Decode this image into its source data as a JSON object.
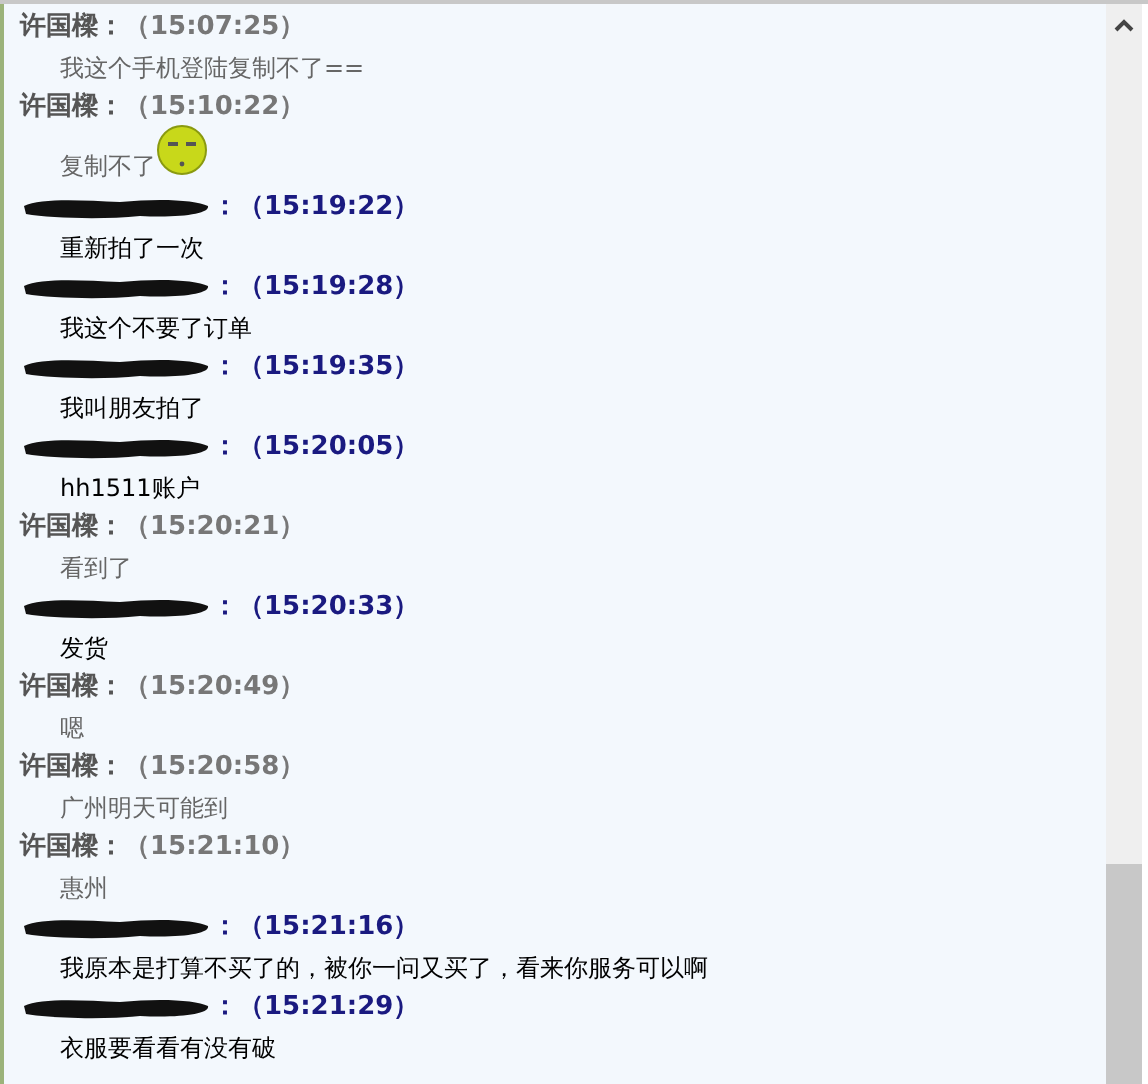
{
  "messages": [
    {
      "kind": "seller",
      "sender": "许国樑：",
      "time": "（15:07:25）",
      "text": "我这个手机登陆复制不了=="
    },
    {
      "kind": "seller",
      "sender": "许国樑：",
      "time": "（15:10:22）",
      "text": "复制不了",
      "attachments": [
        {
          "kind": "smiley"
        }
      ]
    },
    {
      "kind": "buyer",
      "sender": "：",
      "time": "（15:19:22）",
      "text": "重新拍了一次"
    },
    {
      "kind": "buyer",
      "sender": "：",
      "time": "（15:19:28）",
      "text": "我这个不要了订单"
    },
    {
      "kind": "buyer",
      "sender": "：",
      "time": "（15:19:35）",
      "text": "我叫朋友拍了"
    },
    {
      "kind": "buyer",
      "sender": "：",
      "time": "（15:20:05）",
      "text": "hh1511账户"
    },
    {
      "kind": "seller",
      "sender": "许国樑：",
      "time": "（15:20:21）",
      "text": "看到了"
    },
    {
      "kind": "buyer",
      "sender": "：",
      "time": "（15:20:33）",
      "text": "发货"
    },
    {
      "kind": "seller",
      "sender": "许国樑：",
      "time": "（15:20:49）",
      "text": "嗯"
    },
    {
      "kind": "seller",
      "sender": "许国樑：",
      "time": "（15:20:58）",
      "text": "广州明天可能到"
    },
    {
      "kind": "seller",
      "sender": "许国樑：",
      "time": "（15:21:10）",
      "text": "惠州"
    },
    {
      "kind": "buyer",
      "sender": "：",
      "time": "（15:21:16）",
      "text": "我原本是打算不买了的，被你一问又买了，看来你服务可以啊"
    },
    {
      "kind": "buyer",
      "sender": "：",
      "time": "（15:21:29）",
      "text": "衣服要看看有没有破"
    }
  ]
}
